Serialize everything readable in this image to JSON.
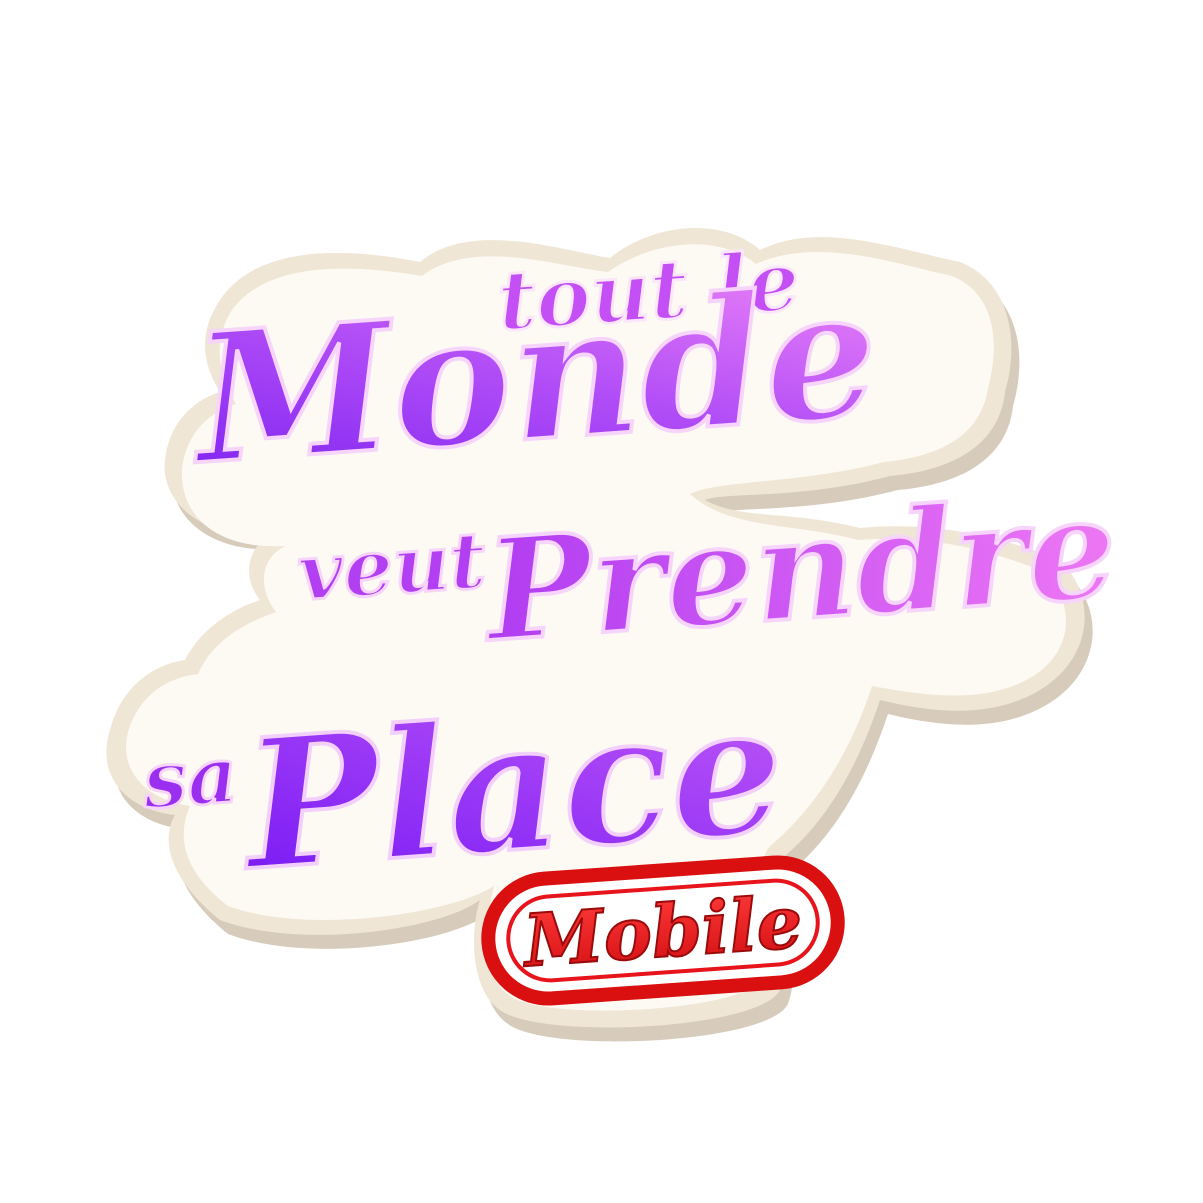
{
  "logo": {
    "line1_small": "tout le",
    "line2_big": "Monde",
    "line3_small": "veut",
    "line3_big": "Prendre",
    "line4_small": "sa",
    "line4_big": "Place",
    "badge": "Mobile"
  },
  "colors": {
    "background": "#ffffff",
    "plate_face": "#fdfaf5",
    "plate_outline": "#ece3d2",
    "plate_side": "#d9cfbf",
    "purple_dark": "#8a2be2",
    "purple_mid": "#b04ef5",
    "pink_light": "#f07cf5",
    "badge_red": "#e8141b",
    "badge_border": "#d20f16"
  }
}
